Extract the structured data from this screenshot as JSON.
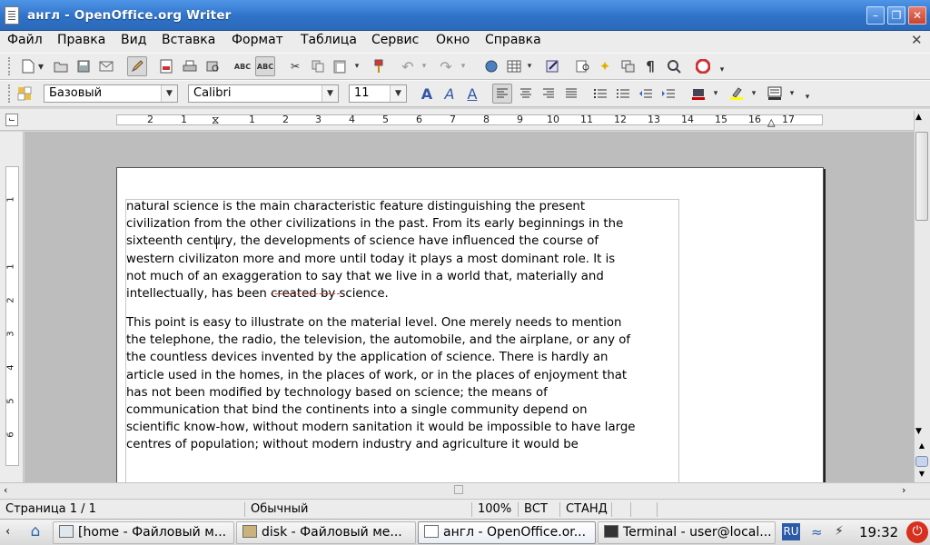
{
  "window": {
    "title": "англ - OpenOffice.org Writer"
  },
  "menu": [
    "Файл",
    "Правка",
    "Вид",
    "Вставка",
    "Формат",
    "Таблица",
    "Сервис",
    "Окно",
    "Справка"
  ],
  "format": {
    "style": "Базовый",
    "font": "Calibri",
    "size": "11"
  },
  "ruler": {
    "h": [
      "2",
      "1",
      "1",
      "2",
      "3",
      "4",
      "5",
      "6",
      "7",
      "8",
      "9",
      "10",
      "11",
      "12",
      "13",
      "14",
      "15",
      "16",
      "17"
    ],
    "v": [
      "1",
      "1",
      "2",
      "3",
      "4",
      "5",
      "6"
    ]
  },
  "document": {
    "para1": "natural science is the main characteristic feature distinguishing the present\ncivilization from the other civilizations in the past. From its early beginnings in the\nsixteenth century, the developments of science have influenced the course of\nwestern civilizaton more and more until today it plays a most dominant role. It is\nnot much of an exaggeration to say that we live in a world that, materially and\nintellectually, has been created by science.",
    "para2": "This point is easy to illustrate on the material level. One merely needs to mention\nthe telephone, the radio, the television, the automobile, and the airplane, or any of\nthe countless devices invented by the application of science. There is hardly an\narticle used in the homes, in the places of work, or in the places of enjoyment that\nhas not been modified by technology based on science; the means of\ncommunication that bind the continents into a single community depend on\nscientific know-how, without modern sanitation it would be impossible to have large\ncentres of population; without modern industry and agriculture it would be"
  },
  "status": {
    "page": "Страница  1 / 1",
    "style": "Обычный",
    "zoom": "100%",
    "insert": "ВСТ",
    "mode": "СТАНД"
  },
  "taskbar": {
    "tasks": [
      "[home - Файловый м...",
      "disk - Файловый ме...",
      "англ - OpenOffice.or...",
      "Terminal - user@local..."
    ],
    "lang": "RU",
    "time": "19:32"
  },
  "colors": {
    "titlebar": "#3a7fd5",
    "page": "#ffffff",
    "canvas": "#bdbdbd"
  }
}
